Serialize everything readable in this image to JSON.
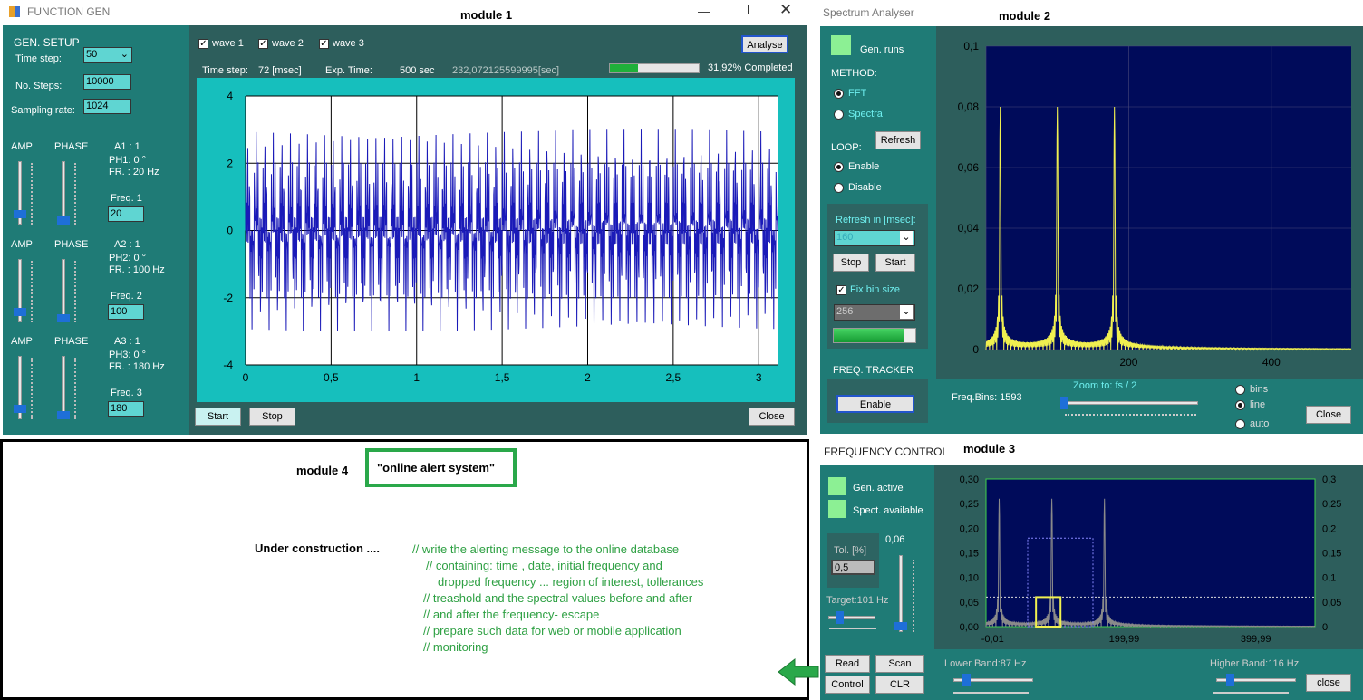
{
  "module1": {
    "window_title": "FUNCTION GEN",
    "label": "module 1",
    "gen_setup": "GEN. SETUP",
    "time_step_label": "Time step:",
    "time_step_value": "50",
    "no_steps_label": "No. Steps:",
    "no_steps_value": "10000",
    "sampling_label": "Sampling rate:",
    "sampling_value": "1024",
    "waves": [
      {
        "amp": "AMP",
        "phase": "PHASE",
        "a": "A1 : 1",
        "ph": "PH1: 0 °",
        "fr": "FR. : 20 Hz",
        "freq_label": "Freq. 1",
        "freq_value": "20"
      },
      {
        "amp": "AMP",
        "phase": "PHASE",
        "a": "A2 : 1",
        "ph": "PH2: 0 °",
        "fr": "FR. : 100 Hz",
        "freq_label": "Freq. 2",
        "freq_value": "100"
      },
      {
        "amp": "AMP",
        "phase": "PHASE",
        "a": "A3 : 1",
        "ph": "PH3: 0 °",
        "fr": "FR. : 180 Hz",
        "freq_label": "Freq. 3",
        "freq_value": "180"
      }
    ],
    "checks": [
      "wave 1",
      "wave 2",
      "wave 3"
    ],
    "analyse": "Analyse",
    "status_time_step_label": "Time step:",
    "status_time_step_value": "72 [msec]",
    "exp_time_label": "Exp. Time:",
    "exp_time_value": "500 sec",
    "elapsed": "232,072125599995[sec]",
    "progress": 0.3192,
    "progress_text": "31,92% Completed",
    "start": "Start",
    "stop": "Stop",
    "close": "Close",
    "chart": {
      "y_ticks": [
        "4",
        "2",
        "0",
        "-2",
        "-4"
      ],
      "x_ticks": [
        "0",
        "0,5",
        "1",
        "1,5",
        "2",
        "2,5",
        "3"
      ]
    }
  },
  "module2": {
    "window_title": "Spectrum Analyser",
    "label": "module 2",
    "gen_runs": "Gen. runs",
    "method": "METHOD:",
    "fft": "FFT",
    "spectra": "Spectra",
    "refresh": "Refresh",
    "loop": "LOOP:",
    "enable": "Enable",
    "disable": "Disable",
    "refresh_in": "Refresh in [msec]:",
    "refresh_value": "160",
    "stop": "Stop",
    "start": "Start",
    "fix_bin": "Fix bin size",
    "bin_value": "256",
    "freq_tracker": "FREQ. TRACKER",
    "tracker_enable": "Enable",
    "freq_bins": "Freq.Bins: 1593",
    "zoom": "Zoom to: fs / 2",
    "bins": "bins",
    "line": "line",
    "auto": "auto",
    "close": "Close",
    "chart": {
      "y_ticks": [
        "0,1",
        "0,08",
        "0,06",
        "0,04",
        "0,02",
        "0"
      ],
      "x_ticks": [
        "200",
        "400"
      ]
    }
  },
  "module3": {
    "window_title": "FREQUENCY CONTROL",
    "label": "module 3",
    "gen_active": "Gen. active",
    "spect_available": "Spect. available",
    "tol_label": "Tol. [%]",
    "tol_value": "0,5",
    "slider_value": "0,06",
    "target": "Target:101 Hz",
    "read": "Read",
    "scan": "Scan",
    "control": "Control",
    "clr": "CLR",
    "lower_band": "Lower Band:87 Hz",
    "higher_band": "Higher Band:116 Hz",
    "close": "close",
    "chart": {
      "y_ticks": [
        "0,30",
        "0,25",
        "0,20",
        "0,15",
        "0,10",
        "0,05",
        "0,00"
      ],
      "y2_ticks": [
        "0,3",
        "0,25",
        "0,2",
        "0,15",
        "0,1",
        "0,05",
        "0"
      ],
      "x_ticks": [
        "-0,01",
        "199,99",
        "399,99"
      ]
    }
  },
  "module4": {
    "label": "module 4",
    "title": "\"online alert system\"",
    "under": "Under construction ....",
    "comments": [
      "// write the alerting message to the online database",
      "// containing:  time , date, initial frequency and",
      "dropped frequency ... region of interest, tollerances",
      "// treashold and the spectral values before and after",
      "// and after the frequency- escape",
      "// prepare such  data for web or mobile application",
      "// monitoring"
    ]
  },
  "colors": {
    "teal": "#1f7b76",
    "cyan": "#16bfbd",
    "navy": "#000b5a",
    "wave": "#1a1ab8",
    "spectrum": "#f0f050",
    "accent": "#2aa84a"
  }
}
